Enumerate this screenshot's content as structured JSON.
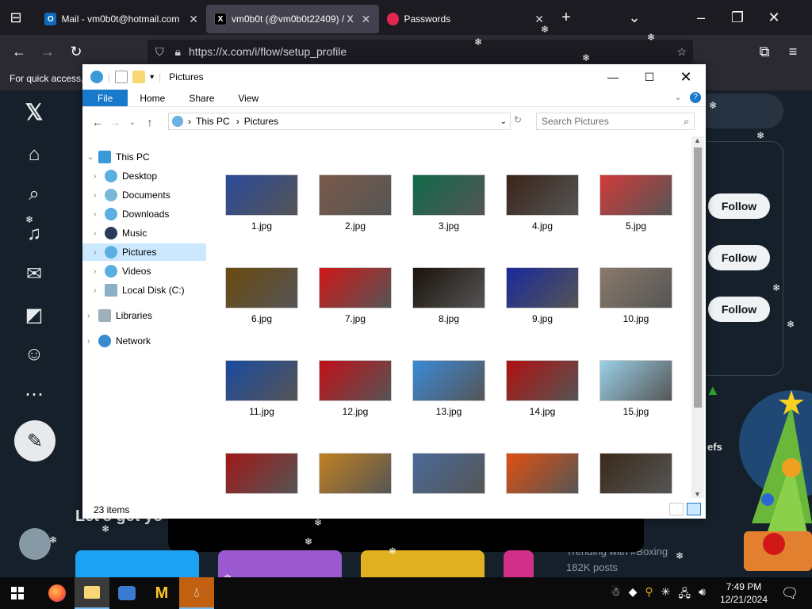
{
  "browser": {
    "tabs": [
      {
        "title": "Mail - vm0b0t@hotmail.com -",
        "icon": "outlook-icon",
        "color": "#0f6cbd"
      },
      {
        "title": "vm0b0t (@vm0b0t22409) / X",
        "icon": "x-icon",
        "color": "#000000",
        "active": true
      },
      {
        "title": "Passwords",
        "icon": "firefox-passwords-icon",
        "color": "#e22850"
      }
    ],
    "url": "https://x.com/i/flow/setup_profile",
    "bookmark_hint": "For quick access,"
  },
  "x_page": {
    "follow_labels": [
      "Follow",
      "Follow",
      "Follow"
    ],
    "trending_text": "Trending with #Boxing",
    "posts_count": "182K posts",
    "partial_text": "efs",
    "lets_get": "Let's get yo"
  },
  "explorer": {
    "title": "Pictures",
    "ribbon_tabs": [
      "File",
      "Home",
      "Share",
      "View"
    ],
    "breadcrumb": [
      "This PC",
      "Pictures"
    ],
    "search_placeholder": "Search Pictures",
    "nav": {
      "this_pc": "This PC",
      "desktop": "Desktop",
      "documents": "Documents",
      "downloads": "Downloads",
      "music": "Music",
      "pictures": "Pictures",
      "videos": "Videos",
      "local_disk": "Local Disk (C:)",
      "libraries": "Libraries",
      "network": "Network"
    },
    "files": [
      {
        "name": "1.jpg",
        "color": "#2a4a9a"
      },
      {
        "name": "2.jpg",
        "color": "#7a5a4a"
      },
      {
        "name": "3.jpg",
        "color": "#0f6b4a"
      },
      {
        "name": "4.jpg",
        "color": "#3a2418"
      },
      {
        "name": "5.jpg",
        "color": "#d23a3a"
      },
      {
        "name": "6.jpg",
        "color": "#6a4a10"
      },
      {
        "name": "7.jpg",
        "color": "#d01818"
      },
      {
        "name": "8.jpg",
        "color": "#1a120a"
      },
      {
        "name": "9.jpg",
        "color": "#1a2a9a"
      },
      {
        "name": "10.jpg",
        "color": "#8a7a6a"
      },
      {
        "name": "11.jpg",
        "color": "#1a4aa0"
      },
      {
        "name": "12.jpg",
        "color": "#c01018"
      },
      {
        "name": "13.jpg",
        "color": "#3a8ad8"
      },
      {
        "name": "14.jpg",
        "color": "#b01010"
      },
      {
        "name": "15.jpg",
        "color": "#9ad0e8"
      },
      {
        "name": "",
        "color": "#a01818"
      },
      {
        "name": "",
        "color": "#c08020"
      },
      {
        "name": "",
        "color": "#4a6a9a"
      },
      {
        "name": "",
        "color": "#e05010"
      },
      {
        "name": "",
        "color": "#3a2a1a"
      }
    ],
    "status": "23 items"
  },
  "taskbar": {
    "time": "7:49 PM",
    "date": "12/21/2024"
  }
}
